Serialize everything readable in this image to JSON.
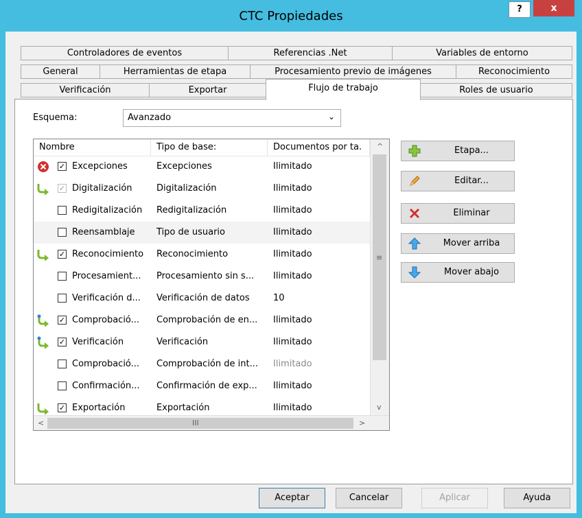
{
  "window": {
    "title": "CTC Propiedades",
    "help_label": "?",
    "close_label": "x"
  },
  "tabs": {
    "row1": [
      "Controladores de eventos",
      "Referencias .Net",
      "Variables de entorno"
    ],
    "row2": [
      "General",
      "Herramientas de etapa",
      "Procesamiento previo de imágenes",
      "Reconocimiento"
    ],
    "row3": [
      "Verificación",
      "Exportar",
      "Flujo de trabajo",
      "Roles de usuario"
    ],
    "active": "Flujo de trabajo"
  },
  "schema": {
    "label": "Esquema:",
    "value": "Avanzado"
  },
  "stages": {
    "columns": [
      "Nombre",
      "Tipo de base:",
      "Documentos por ta."
    ],
    "rows": [
      {
        "icon": "error-icon",
        "checked": true,
        "dim": false,
        "name": "Excepciones",
        "type": "Excepciones",
        "docs": "Ilimitado"
      },
      {
        "icon": "arrow-right-icon",
        "checked": true,
        "dim": true,
        "name": "Digitalización",
        "type": "Digitalización",
        "docs": "Ilimitado"
      },
      {
        "icon": "",
        "checked": false,
        "dim": false,
        "name": "Redigitalización",
        "type": "Redigitalización",
        "docs": "Ilimitado"
      },
      {
        "icon": "",
        "checked": false,
        "dim": false,
        "name": "Reensamblaje",
        "type": "Tipo de usuario",
        "docs": "Ilimitado"
      },
      {
        "icon": "arrow-right-icon",
        "checked": true,
        "dim": false,
        "name": "Reconocimiento",
        "type": "Reconocimiento",
        "docs": "Ilimitado"
      },
      {
        "icon": "",
        "checked": false,
        "dim": false,
        "name": "Procesamient...",
        "type": "Procesamiento sin s...",
        "docs": "Ilimitado"
      },
      {
        "icon": "",
        "checked": false,
        "dim": false,
        "name": "Verificación d...",
        "type": "Verificación de datos",
        "docs": "10"
      },
      {
        "icon": "arrow-return-icon",
        "checked": true,
        "dim": false,
        "name": "Comprobació...",
        "type": "Comprobación de en...",
        "docs": "Ilimitado"
      },
      {
        "icon": "arrow-return-icon",
        "checked": true,
        "dim": false,
        "name": "Verificación",
        "type": "Verificación",
        "docs": "Ilimitado"
      },
      {
        "icon": "",
        "checked": false,
        "dim": false,
        "name": "Comprobació...",
        "type": "Comprobación de int...",
        "docs": "Ilimitado"
      },
      {
        "icon": "",
        "checked": false,
        "dim": false,
        "name": "Confirmación...",
        "type": "Confirmación de exp...",
        "docs": "Ilimitado"
      },
      {
        "icon": "arrow-right-icon",
        "checked": true,
        "dim": false,
        "name": "Exportación",
        "type": "Exportación",
        "docs": "Ilimitado"
      }
    ],
    "selected_row": 3,
    "scroll_up": "^",
    "scroll_mid": "≡",
    "scroll_down": "v",
    "scroll_left": "<",
    "scroll_hmid": "III",
    "scroll_right": ">"
  },
  "side_buttons": {
    "add": "Etapa...",
    "edit": "Editar...",
    "delete": "Eliminar",
    "up": "Mover arriba",
    "down": "Mover abajo"
  },
  "bottom_buttons": {
    "ok": "Aceptar",
    "cancel": "Cancelar",
    "apply": "Aplicar",
    "help": "Ayuda"
  },
  "colors": {
    "frame": "#44bde0",
    "close": "#c74140",
    "arrow_green": "#7cb82f",
    "error_red": "#d0312d"
  }
}
